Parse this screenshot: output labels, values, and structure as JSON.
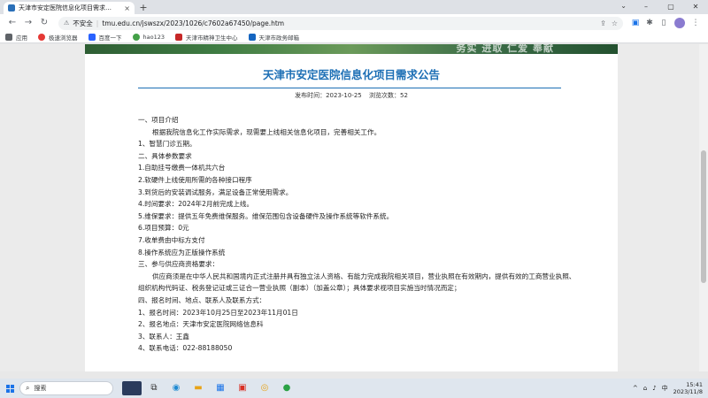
{
  "browser": {
    "tab_title": "天津市安定医院信息化项目需求…",
    "tab_close": "×",
    "new_tab": "+",
    "tab_menu": "⌄",
    "window_controls": [
      "–",
      "▢",
      "✕"
    ],
    "nav": {
      "back": "←",
      "forward": "→",
      "reload": "↻"
    },
    "security_label": "不安全",
    "url": "tmu.edu.cn/jswszx/2023/1026/c7602a67450/page.htm",
    "toolbar_icons": [
      "share-icon",
      "star-icon",
      "extension-blue-icon",
      "puzzle-icon",
      "sidebar-icon",
      "profile-icon",
      "menu-icon"
    ]
  },
  "bookmarks": [
    {
      "label": "应用",
      "color": "#5f6368"
    },
    {
      "label": "极速浏览器",
      "color": "#e53935"
    },
    {
      "label": "百度一下",
      "color": "#2962ff"
    },
    {
      "label": "hao123",
      "color": "#43a047"
    },
    {
      "label": "天津市精神卫生中心",
      "color": "#c62828"
    },
    {
      "label": "天津市政务邮箱",
      "color": "#1565c0"
    }
  ],
  "banner_text": "务实 进取 仁爱 奉献",
  "article": {
    "title": "天津市安定医院信息化项目需求公告",
    "publish_label": "发布时间：",
    "publish_date": "2023-10-25",
    "views_label": "浏览次数：",
    "views": "52",
    "lines": [
      "一、项目介绍",
      "根据我院信息化工作实际需求，现需要上线相关信息化项目，完善相关工作。",
      "1、智慧门诊五期。",
      "二、具体参数要求",
      "1.自助挂号缴费一体机共六台",
      "2.软硬件上线使用所需的各种接口程序",
      "3.到货后的安装调试服务，满足设备正常使用需求。",
      "4.时间要求：2024年2月前完成上线。",
      "5.维保要求：提供五年免费维保服务。维保范围包含设备硬件及操作系统等软件系统。",
      "6.项目预算：0元",
      "7.收单费由中标方支付",
      "8.操作系统应为正版操作系统",
      "三、参与供应商资格要求：",
      "供应商须是在中华人民共和国境内正式注册并具有独立法人资格、有能力完成我院相关项目，营业执照在有效期内，提供有效的工商营业执照、组织机构代码证、税务登记证或三证合一营业执照（副本）（加盖公章）；具体要求视项目实施当时情况而定；",
      "四、报名时间、地点、联系人及联系方式：",
      "1、报名时间：2023年10月25日至2023年11月01日",
      "2、报名地点：天津市安定医院网络信息科",
      "3、联系人：王鑫",
      "4、联系电话：022-88188050"
    ]
  },
  "taskbar": {
    "search_label": "搜索",
    "tray_lang": "中",
    "tray_misc": "^",
    "time": "15:41",
    "date": "2023/11/8"
  }
}
